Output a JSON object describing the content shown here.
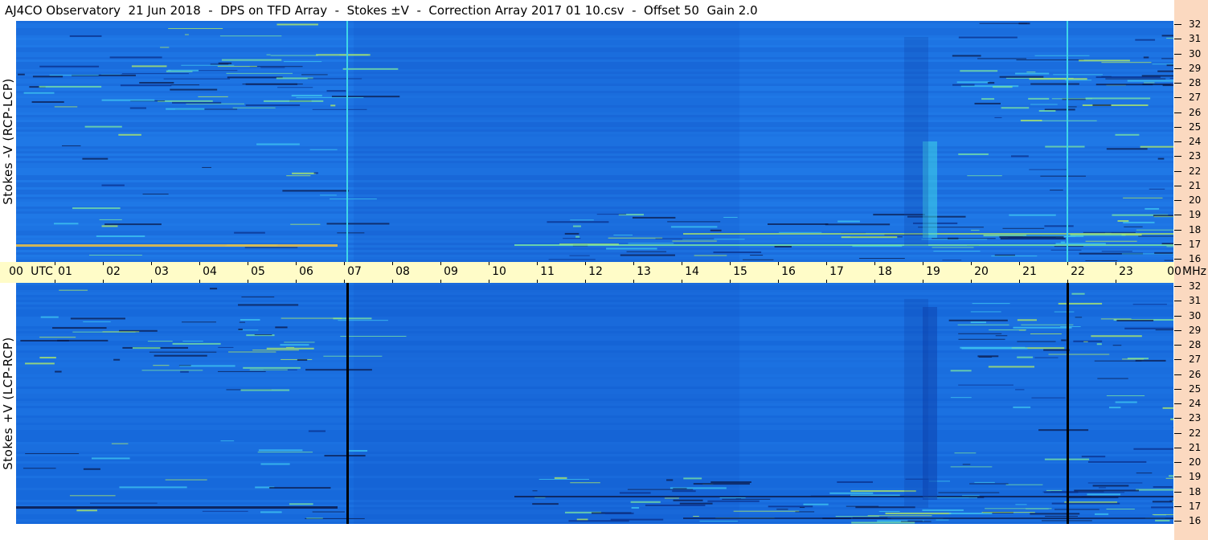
{
  "title": "AJ4CO Observatory  21 Jun 2018  -  DPS on TFD Array  -  Stokes ±V  -  Correction Array 2017 01 10.csv  -  Offset 50  Gain 2.0",
  "panels": {
    "top": {
      "label": "Stokes -V (RCP-LCP)"
    },
    "bottom": {
      "label": "Stokes +V (LCP-RCP)"
    }
  },
  "time_axis": {
    "start_label": "00",
    "utc_label": "UTC",
    "end_label": "00",
    "mhz_label": "MHz",
    "hours": [
      "01",
      "02",
      "03",
      "04",
      "05",
      "06",
      "07",
      "08",
      "09",
      "10",
      "11",
      "12",
      "13",
      "14",
      "15",
      "16",
      "17",
      "18",
      "19",
      "20",
      "21",
      "22",
      "23"
    ]
  },
  "frequency_axis": {
    "labels": [
      "32",
      "31",
      "30",
      "29",
      "28",
      "27",
      "26",
      "25",
      "24",
      "23",
      "22",
      "21",
      "20",
      "19",
      "18",
      "17",
      "16"
    ]
  },
  "colors": {
    "background_blue": "#1a6fe0",
    "strip": "#fbd9c0",
    "time_axis_bg": "#fffcc8",
    "rfi_dark": "#0b1a4a",
    "rfi_bright": "#7de8a0"
  }
}
